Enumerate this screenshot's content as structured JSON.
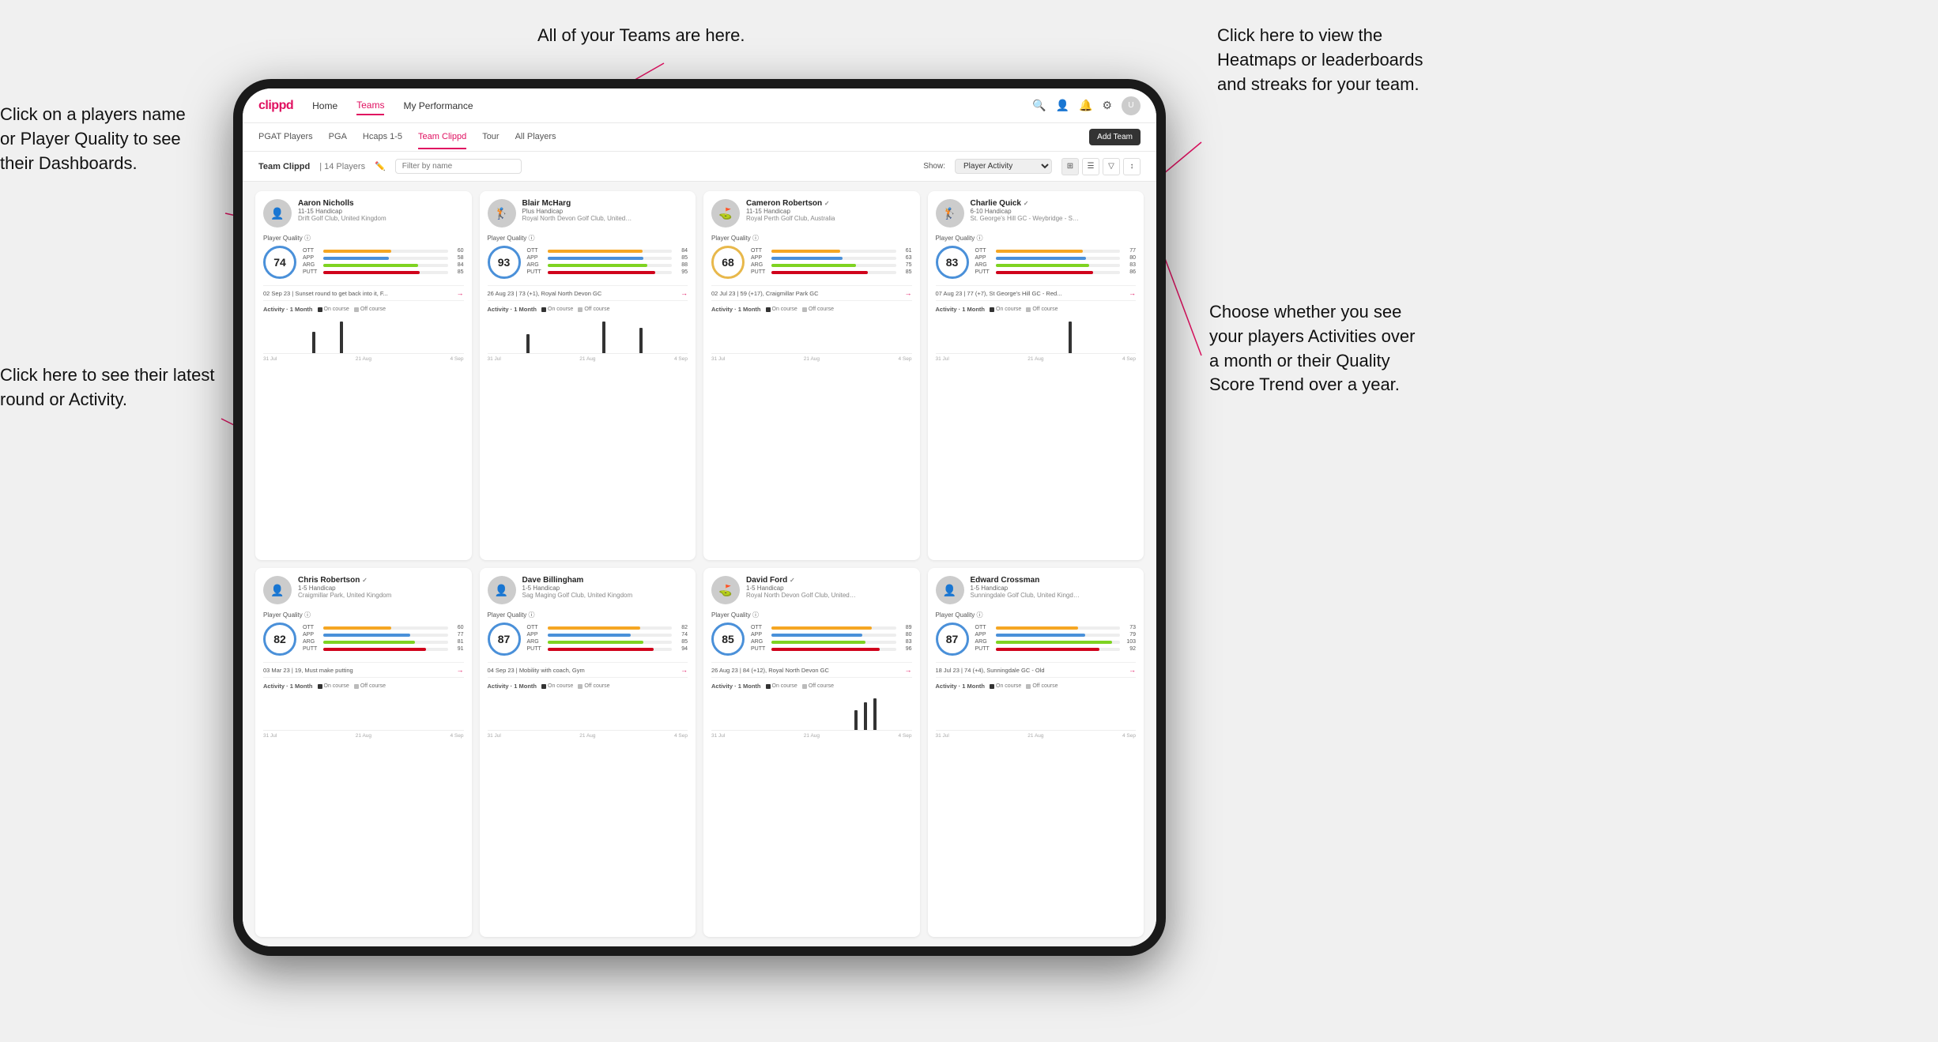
{
  "annotations": {
    "ann1_title": "Click on a players name",
    "ann1_line2": "or Player Quality to see",
    "ann1_line3": "their Dashboards.",
    "ann2_title": "Click here to see their latest",
    "ann2_line2": "round or Activity.",
    "ann3": "All of your Teams are here.",
    "ann4_line1": "Click here to view the",
    "ann4_line2": "Heatmaps or leaderboards",
    "ann4_line3": "and streaks for your team.",
    "ann5_line1": "Choose whether you see",
    "ann5_line2": "your players Activities over",
    "ann5_line3": "a month or their Quality",
    "ann5_line4": "Score Trend over a year."
  },
  "nav": {
    "logo": "clippd",
    "items": [
      "Home",
      "Teams",
      "My Performance"
    ],
    "active": "Teams"
  },
  "sub_nav": {
    "items": [
      "PGAT Players",
      "PGA",
      "Hcaps 1-5",
      "Team Clippd",
      "Tour",
      "All Players"
    ],
    "active": "Team Clippd",
    "add_btn": "Add Team"
  },
  "team_header": {
    "title": "Team Clippd",
    "separator": "|",
    "count": "14 Players",
    "filter_placeholder": "Filter by name",
    "show_label": "Show:",
    "show_value": "Player Activity",
    "add_btn": "Add Team"
  },
  "players": [
    {
      "name": "Aaron Nicholls",
      "handicap": "11-15 Handicap",
      "club": "Drift Golf Club, United Kingdom",
      "score": 74,
      "score_color": "#4a90d9",
      "stats": [
        {
          "label": "OTT",
          "value": 60,
          "color": "#f5a623"
        },
        {
          "label": "APP",
          "value": 58,
          "color": "#4a90d9"
        },
        {
          "label": "ARG",
          "value": 84,
          "color": "#7ed321"
        },
        {
          "label": "PUTT",
          "value": 85,
          "color": "#d0021b"
        }
      ],
      "recent": "02 Sep 23 | Sunset round to get back into it, F...",
      "chart_data": [
        0,
        0,
        0,
        0,
        0,
        2,
        0,
        0,
        3,
        0,
        0,
        0,
        0,
        0,
        0,
        0,
        0,
        0,
        0,
        0,
        0
      ],
      "dates": [
        "31 Jul",
        "21 Aug",
        "4 Sep"
      ],
      "emoji": "👤"
    },
    {
      "name": "Blair McHarg",
      "handicap": "Plus Handicap",
      "club": "Royal North Devon Golf Club, United Ki...",
      "score": 93,
      "score_color": "#4a90d9",
      "stats": [
        {
          "label": "OTT",
          "value": 84,
          "color": "#f5a623"
        },
        {
          "label": "APP",
          "value": 85,
          "color": "#4a90d9"
        },
        {
          "label": "ARG",
          "value": 88,
          "color": "#7ed321"
        },
        {
          "label": "PUTT",
          "value": 95,
          "color": "#d0021b"
        }
      ],
      "recent": "26 Aug 23 | 73 (+1), Royal North Devon GC",
      "chart_data": [
        0,
        0,
        0,
        0,
        3,
        0,
        0,
        0,
        0,
        0,
        0,
        0,
        5,
        0,
        0,
        0,
        4,
        0,
        0,
        0,
        0
      ],
      "dates": [
        "31 Jul",
        "21 Aug",
        "4 Sep"
      ],
      "emoji": "🏌️"
    },
    {
      "name": "Cameron Robertson",
      "handicap": "11-15 Handicap",
      "club": "Royal Perth Golf Club, Australia",
      "score": 68,
      "score_color": "#e8b84b",
      "stats": [
        {
          "label": "OTT",
          "value": 61,
          "color": "#f5a623"
        },
        {
          "label": "APP",
          "value": 63,
          "color": "#4a90d9"
        },
        {
          "label": "ARG",
          "value": 75,
          "color": "#7ed321"
        },
        {
          "label": "PUTT",
          "value": 85,
          "color": "#d0021b"
        }
      ],
      "recent": "02 Jul 23 | 59 (+17), Craigmillar Park GC",
      "chart_data": [
        0,
        0,
        0,
        0,
        0,
        0,
        0,
        0,
        0,
        0,
        0,
        0,
        0,
        0,
        0,
        0,
        0,
        0,
        0,
        0,
        0
      ],
      "dates": [
        "31 Jul",
        "21 Aug",
        "4 Sep"
      ],
      "emoji": "⛳",
      "verified": true
    },
    {
      "name": "Charlie Quick",
      "handicap": "6-10 Handicap",
      "club": "St. George's Hill GC - Weybridge - Surre...",
      "score": 83,
      "score_color": "#4a90d9",
      "stats": [
        {
          "label": "OTT",
          "value": 77,
          "color": "#f5a623"
        },
        {
          "label": "APP",
          "value": 80,
          "color": "#4a90d9"
        },
        {
          "label": "ARG",
          "value": 83,
          "color": "#7ed321"
        },
        {
          "label": "PUTT",
          "value": 86,
          "color": "#d0021b"
        }
      ],
      "recent": "07 Aug 23 | 77 (+7), St George's Hill GC - Red...",
      "chart_data": [
        0,
        0,
        0,
        0,
        0,
        0,
        0,
        0,
        0,
        0,
        0,
        0,
        0,
        0,
        4,
        0,
        0,
        0,
        0,
        0,
        0
      ],
      "dates": [
        "31 Jul",
        "21 Aug",
        "4 Sep"
      ],
      "emoji": "🏌️",
      "verified": true
    },
    {
      "name": "Chris Robertson",
      "handicap": "1-5 Handicap",
      "club": "Craigmillar Park, United Kingdom",
      "score": 82,
      "score_color": "#4a90d9",
      "stats": [
        {
          "label": "OTT",
          "value": 60,
          "color": "#f5a623"
        },
        {
          "label": "APP",
          "value": 77,
          "color": "#4a90d9"
        },
        {
          "label": "ARG",
          "value": 81,
          "color": "#7ed321"
        },
        {
          "label": "PUTT",
          "value": 91,
          "color": "#d0021b"
        }
      ],
      "recent": "03 Mar 23 | 19, Must make putting",
      "chart_data": [
        0,
        0,
        0,
        0,
        0,
        0,
        0,
        0,
        0,
        0,
        0,
        0,
        0,
        0,
        0,
        0,
        0,
        0,
        0,
        0,
        0
      ],
      "dates": [
        "31 Jul",
        "21 Aug",
        "4 Sep"
      ],
      "emoji": "👤",
      "verified": true
    },
    {
      "name": "Dave Billingham",
      "handicap": "1-5 Handicap",
      "club": "Sag Maging Golf Club, United Kingdom",
      "score": 87,
      "score_color": "#4a90d9",
      "stats": [
        {
          "label": "OTT",
          "value": 82,
          "color": "#f5a623"
        },
        {
          "label": "APP",
          "value": 74,
          "color": "#4a90d9"
        },
        {
          "label": "ARG",
          "value": 85,
          "color": "#7ed321"
        },
        {
          "label": "PUTT",
          "value": 94,
          "color": "#d0021b"
        }
      ],
      "recent": "04 Sep 23 | Mobility with coach, Gym",
      "chart_data": [
        0,
        0,
        0,
        0,
        0,
        0,
        0,
        0,
        0,
        0,
        0,
        0,
        0,
        0,
        0,
        0,
        0,
        0,
        0,
        0,
        0
      ],
      "dates": [
        "31 Jul",
        "21 Aug",
        "4 Sep"
      ],
      "emoji": "👤"
    },
    {
      "name": "David Ford",
      "handicap": "1-5 Handicap",
      "club": "Royal North Devon Golf Club, United Kin...",
      "score": 85,
      "score_color": "#4a90d9",
      "stats": [
        {
          "label": "OTT",
          "value": 89,
          "color": "#f5a623"
        },
        {
          "label": "APP",
          "value": 80,
          "color": "#4a90d9"
        },
        {
          "label": "ARG",
          "value": 83,
          "color": "#7ed321"
        },
        {
          "label": "PUTT",
          "value": 96,
          "color": "#d0021b"
        }
      ],
      "recent": "26 Aug 23 | 84 (+12), Royal North Devon GC",
      "chart_data": [
        0,
        0,
        0,
        0,
        0,
        0,
        0,
        0,
        0,
        0,
        0,
        0,
        0,
        0,
        0,
        5,
        7,
        8,
        0,
        0,
        0
      ],
      "dates": [
        "31 Jul",
        "21 Aug",
        "4 Sep"
      ],
      "emoji": "⛳",
      "verified": true
    },
    {
      "name": "Edward Crossman",
      "handicap": "1-5 Handicap",
      "club": "Sunningdale Golf Club, United Kingdom",
      "score": 87,
      "score_color": "#4a90d9",
      "stats": [
        {
          "label": "OTT",
          "value": 73,
          "color": "#f5a623"
        },
        {
          "label": "APP",
          "value": 79,
          "color": "#4a90d9"
        },
        {
          "label": "ARG",
          "value": 103,
          "color": "#7ed321"
        },
        {
          "label": "PUTT",
          "value": 92,
          "color": "#d0021b"
        }
      ],
      "recent": "18 Jul 23 | 74 (+4), Sunningdale GC - Old",
      "chart_data": [
        0,
        0,
        0,
        0,
        0,
        0,
        0,
        0,
        0,
        0,
        0,
        0,
        0,
        0,
        0,
        0,
        0,
        0,
        0,
        0,
        0
      ],
      "dates": [
        "31 Jul",
        "21 Aug",
        "4 Sep"
      ],
      "emoji": "👤"
    }
  ],
  "activity": {
    "label": "Activity · 1 Month",
    "oncourse": "On course",
    "offcourse": "Off course"
  }
}
